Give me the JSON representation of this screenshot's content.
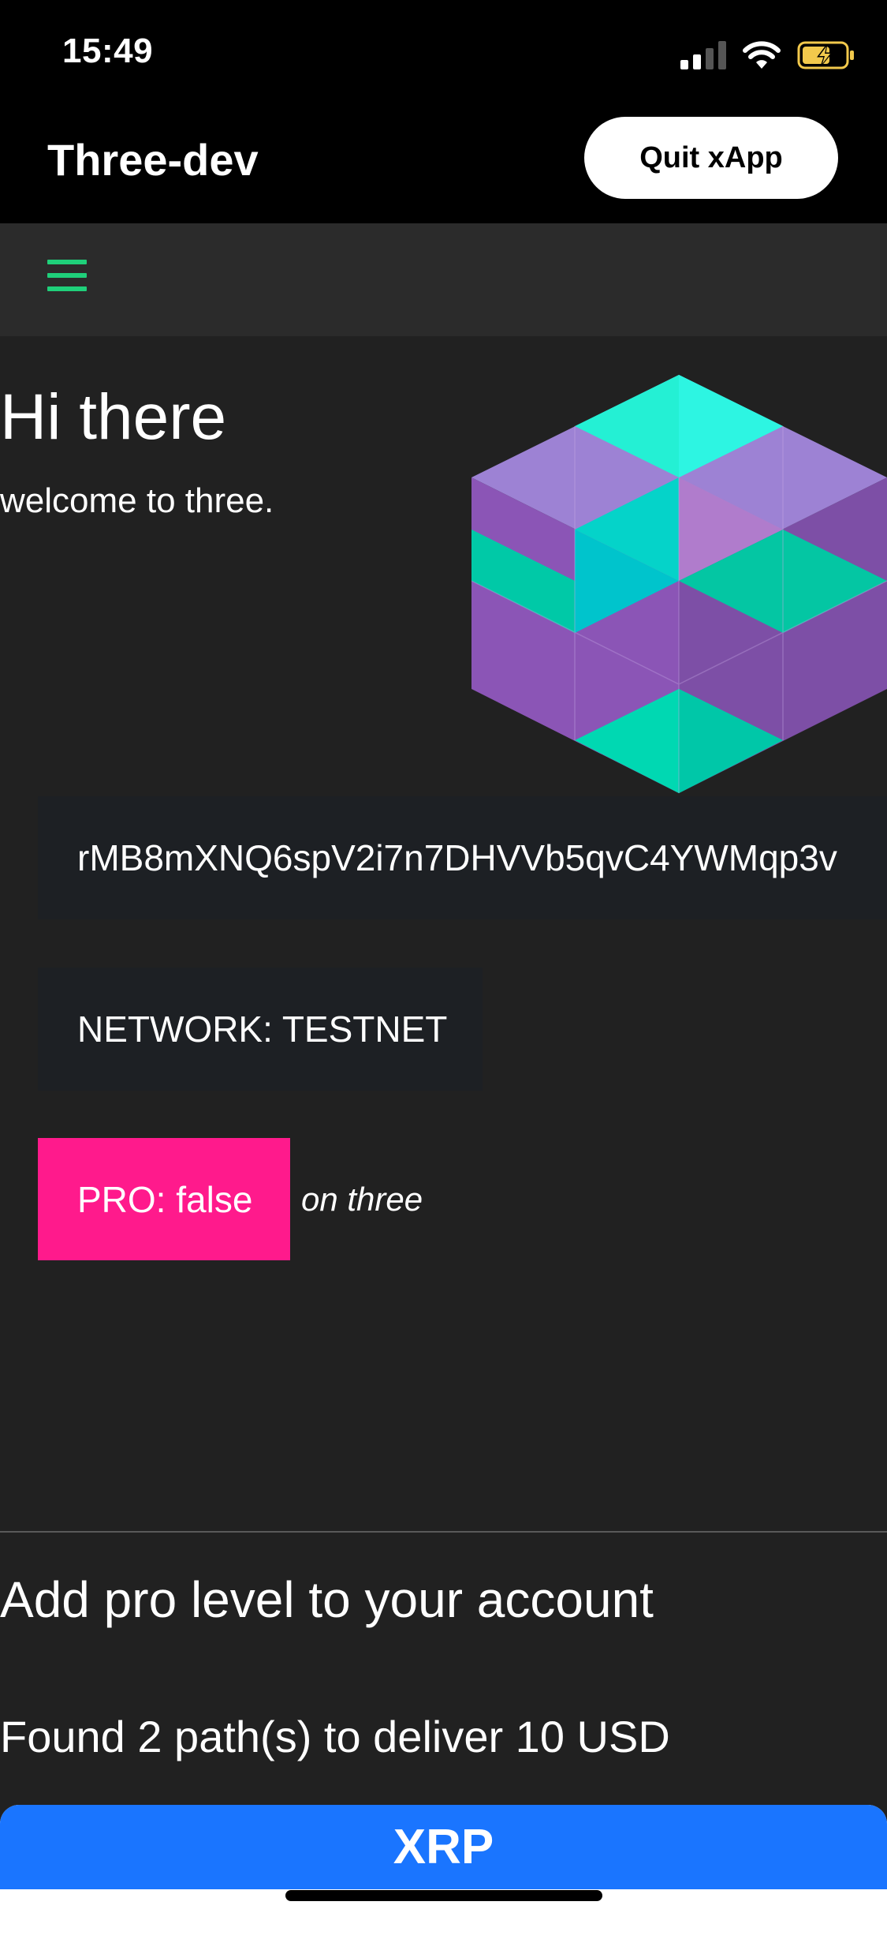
{
  "status_bar": {
    "time": "15:49"
  },
  "app_bar": {
    "title": "Three-dev",
    "quit_label": "Quit xApp"
  },
  "nav": {
    "menu_icon": "hamburger-icon",
    "accent": "#1fd07a"
  },
  "hero": {
    "greeting": "Hi there",
    "welcome": "welcome to three."
  },
  "account": {
    "address": "rMB8mXNQ6spV2i7n7DHVVb5qvC4YWMqp3v",
    "network": "NETWORK: TESTNET",
    "pro": "PRO: false",
    "pro_suffix": "on three",
    "pro_color": "#ff1a8c"
  },
  "upgrade": {
    "title": "Add pro level to your account",
    "paths": "Found 2 path(s) to deliver 10 USD",
    "first_option": "XRP",
    "option_color": "#1a75ff"
  }
}
